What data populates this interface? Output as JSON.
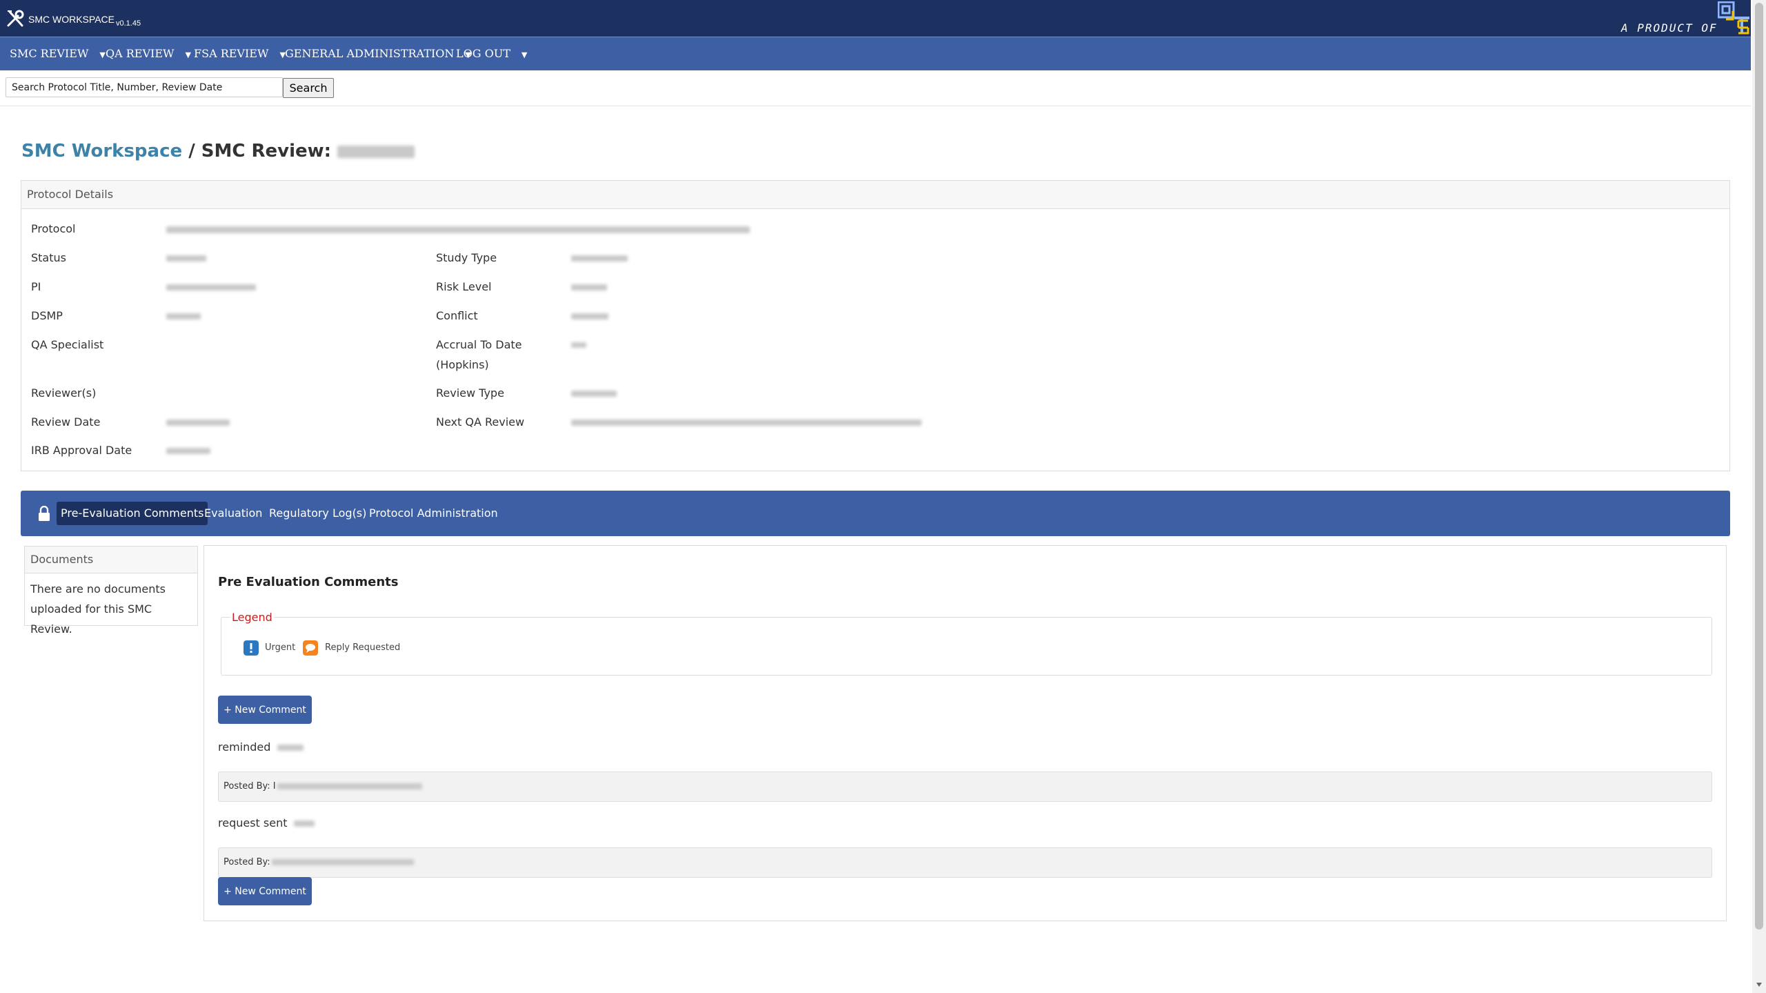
{
  "app": {
    "name": "SMC WORKSPACE",
    "version": "v0.1.45",
    "tagline": "A PRODUCT OF",
    "tools_icon": "tools-icon",
    "logo_icon": "ets-logo-icon",
    "brand_color": "#1d3160",
    "nav_color": "#3d5fa3"
  },
  "nav": {
    "items": [
      {
        "label": "SMC REVIEW",
        "caret": "▼"
      },
      {
        "label": "QA REVIEW",
        "caret": "▼"
      },
      {
        "label": "FSA REVIEW",
        "caret": "▼"
      },
      {
        "label": "GENERAL ADMINISTRATION",
        "caret": "▼"
      },
      {
        "label": "LOG OUT",
        "caret": "▼"
      }
    ]
  },
  "search": {
    "placeholder": "Search Protocol Title, Number, Review Date",
    "button": "Search"
  },
  "page": {
    "crumb_link": "SMC Workspace",
    "separator": " / ",
    "title": "SMC Review:"
  },
  "details": {
    "heading": "Protocol Details",
    "labels": {
      "protocol": "Protocol",
      "status": "Status",
      "pi": "PI",
      "dsmp": "DSMP",
      "qa_specialist": "QA Specialist",
      "reviewers": "Reviewer(s)",
      "review_date": "Review Date",
      "irb_approval_date": "IRB Approval Date",
      "study_type": "Study Type",
      "risk_level": "Risk Level",
      "conflict": "Conflict",
      "accrual_line1": "Accrual To Date",
      "accrual_line2": "(Hopkins)",
      "review_type": "Review Type",
      "next_qa_review": "Next QA Review"
    }
  },
  "tabs": {
    "lock_icon": "lock-icon",
    "items": [
      {
        "label": "Pre-Evaluation Comments",
        "active": true
      },
      {
        "label": "Evaluation",
        "active": false
      },
      {
        "label": "Regulatory Log(s)",
        "active": false
      },
      {
        "label": "Protocol Administration",
        "active": false
      }
    ]
  },
  "documents": {
    "heading": "Documents",
    "empty_line1": "There are no documents",
    "empty_line2": "uploaded for this SMC Review."
  },
  "comments": {
    "title": "Pre Evaluation Comments",
    "legend": {
      "title": "Legend",
      "urgent_icon": "exclamation-icon",
      "urgent_label": "Urgent",
      "urgent_color": "#2a78c2",
      "reply_icon": "reply-icon",
      "reply_label": "Reply Requested",
      "reply_color": "#f5841f"
    },
    "new_button": "+ New Comment",
    "entries": [
      {
        "text": "reminded",
        "posted_by_label": "Posted By: I"
      },
      {
        "text": "request sent",
        "posted_by_label": "Posted By:"
      }
    ]
  }
}
